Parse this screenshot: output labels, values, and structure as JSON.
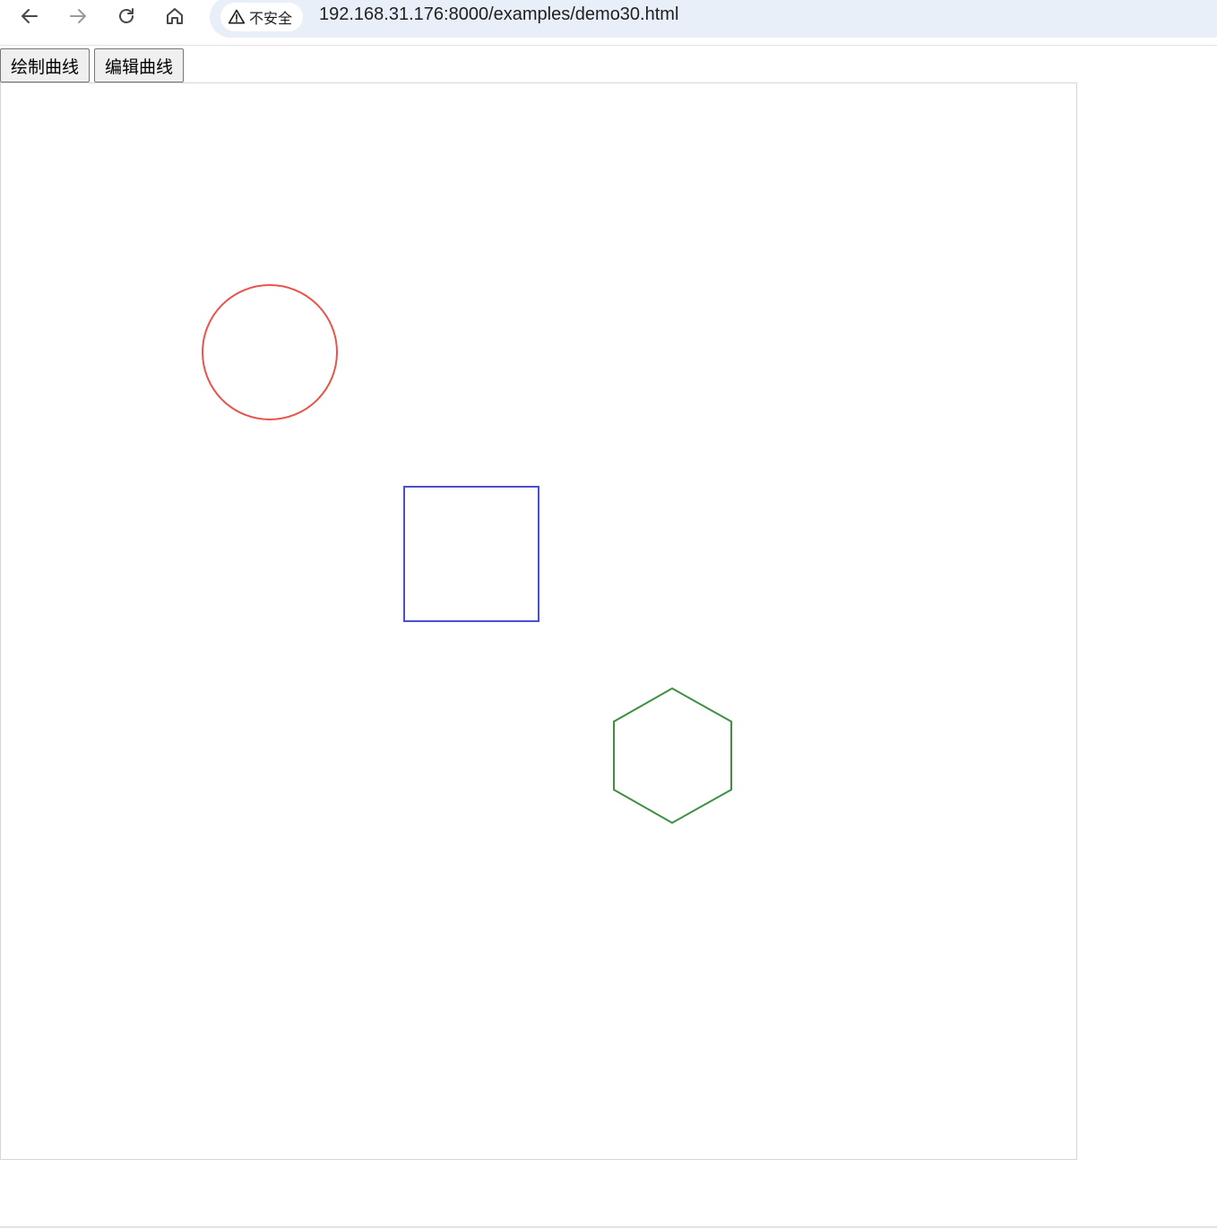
{
  "browser": {
    "security_label": "不安全",
    "url": "192.168.31.176:8000/examples/demo30.html",
    "icons": {
      "back": "arrow-left-icon",
      "forward": "arrow-right-icon",
      "reload": "reload-icon",
      "home": "home-icon",
      "security": "warning-triangle-icon"
    }
  },
  "controls": {
    "draw_curve_label": "绘制曲线",
    "edit_curve_label": "编辑曲线"
  },
  "canvas": {
    "shapes": [
      {
        "kind": "circle",
        "stroke": "#e8534a"
      },
      {
        "kind": "square",
        "stroke": "#4a4fd1"
      },
      {
        "kind": "hexagon",
        "stroke": "#3f8f40"
      }
    ]
  }
}
